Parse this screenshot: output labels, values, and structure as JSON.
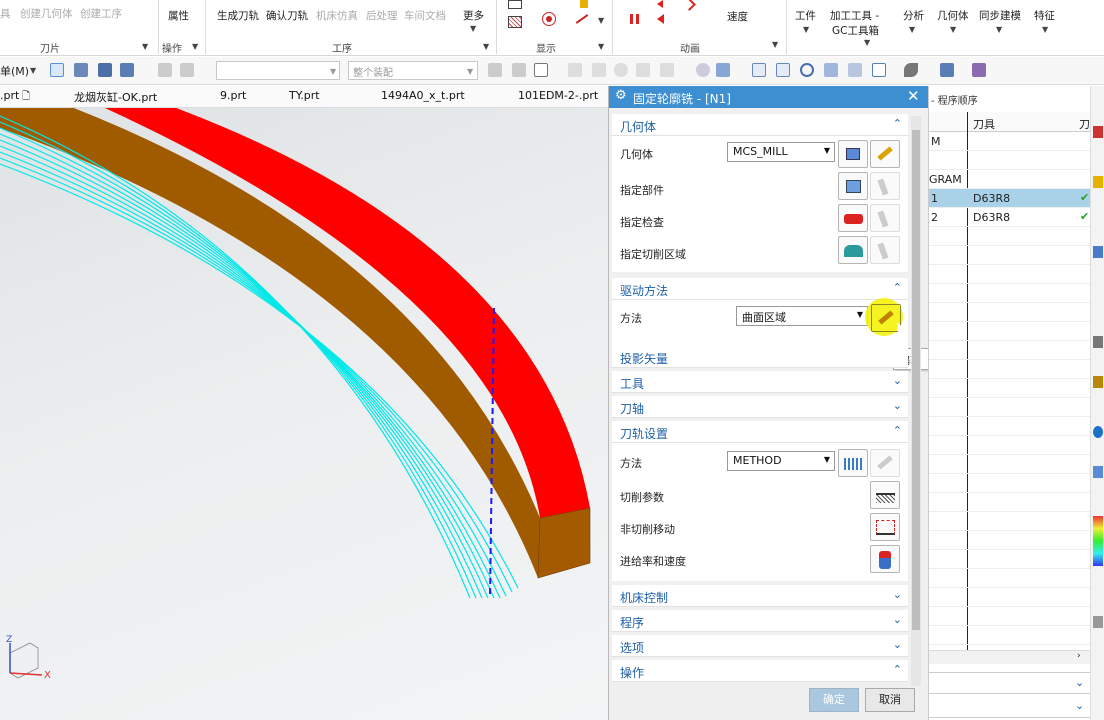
{
  "ribbon": {
    "left_items": [
      "具",
      "创建几何体",
      "创建工序"
    ],
    "property_label": "属性",
    "ops": [
      "生成刀轨",
      "确认刀轨",
      "机床仿真",
      "后处理",
      "车间文档"
    ],
    "more_label": "更多",
    "speed_label": "速度",
    "right_items": [
      "工件",
      "加工工具 -",
      "GC工具箱",
      "分析",
      "几何体",
      "同步建模",
      "特征"
    ],
    "groups": [
      "刀片",
      "操作",
      "工序",
      "显示",
      "动画"
    ]
  },
  "toolbar": {
    "menu_label": "单(M)",
    "filter_placeholder": "",
    "assembly_label": "整个装配"
  },
  "tabs": [
    ".prt",
    "龙烟灰缸-OK.prt",
    "9.prt",
    "TY.prt",
    "1494A0_x_t.prt",
    "101EDM-2-.prt"
  ],
  "dialog": {
    "title": "固定轮廓铣 - [N1]",
    "geometry": {
      "header": "几何体",
      "geom_label": "几何体",
      "geom_value": "MCS_MILL",
      "part_label": "指定部件",
      "check_label": "指定检查",
      "cut_area_label": "指定切削区域"
    },
    "drive": {
      "header": "驱动方法",
      "method_label": "方法",
      "method_value": "曲面区域",
      "tooltip": "编辑"
    },
    "collapsed_1": [
      "投影矢量",
      "工具",
      "刀轴"
    ],
    "toolpath": {
      "header": "刀轨设置",
      "method_label": "方法",
      "method_value": "METHOD",
      "cut_params": "切削参数",
      "noncut": "非切削移动",
      "feeds": "进给率和速度"
    },
    "collapsed_2": [
      "机床控制",
      "程序",
      "选项",
      "操作"
    ],
    "ok_label": "确定",
    "cancel_label": "取消"
  },
  "navigator": {
    "title": "- 程序顺序",
    "col_name": "",
    "col_tool": "刀具",
    "col_extra": "刀",
    "rows": [
      {
        "name": "M",
        "tool": ""
      },
      {
        "name": "",
        "tool": ""
      },
      {
        "name": "GRAM",
        "tool": ""
      },
      {
        "name": "1",
        "tool": "D63R8"
      },
      {
        "name": "2",
        "tool": "D63R8"
      }
    ]
  },
  "axis": {
    "x": "X",
    "z": "Z"
  }
}
